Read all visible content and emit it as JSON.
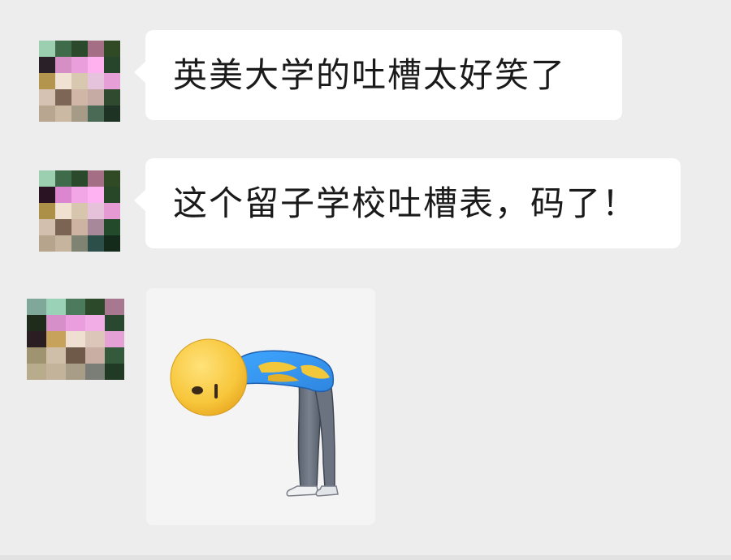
{
  "messages": [
    {
      "type": "text",
      "text": "英美大学的吐槽太好笑了",
      "avatar": {
        "colors": [
          "#9ccfb0",
          "#3f6b4a",
          "#2b4a2c",
          "#a46f84",
          "#2f4a24",
          "#2a2028",
          "#d58fc5",
          "#ea9fdc",
          "#ffb0ef",
          "#27452b",
          "#b4954e",
          "#f1e1d2",
          "#d9c8b0",
          "#e6c3dd",
          "#e79fd8",
          "#d6c2b2",
          "#7e6656",
          "#cfb6a6",
          "#c6aba4",
          "#2f4a2f",
          "#b8a690",
          "#cbb9a4",
          "#a69b86",
          "#4a6a56",
          "#1f3324"
        ]
      }
    },
    {
      "type": "text",
      "text": "这个留子学校吐槽表，码了！",
      "avatar": {
        "colors": [
          "#9ccfb0",
          "#3f6b4a",
          "#2b4a2c",
          "#a46f84",
          "#2f4a24",
          "#2a1424",
          "#dc86cf",
          "#f3a6e6",
          "#ffb2f1",
          "#284628",
          "#ad9048",
          "#efe0d0",
          "#d7c6ad",
          "#e5c1da",
          "#e59ad4",
          "#d2bfae",
          "#7b6452",
          "#ccb3a2",
          "#a7889b",
          "#234a2a",
          "#b7a48d",
          "#c6b49e",
          "#7f8372",
          "#2d4f4a",
          "#142b1c"
        ]
      }
    },
    {
      "type": "sticker",
      "sticker": "bowing-person-emoji",
      "avatar": {
        "colors": [
          "#7fa89a",
          "#9ad2b8",
          "#4c7a5d",
          "#2c4a29",
          "#a77890",
          "#1f2c1c",
          "#d78fca",
          "#ea9ede",
          "#f2ade6",
          "#2a4830",
          "#2a1e22",
          "#c7a25a",
          "#efdfd0",
          "#dcc6ba",
          "#e5a1d6",
          "#a09470",
          "#cfbea8",
          "#6f5a4a",
          "#c8aea3",
          "#325a3b",
          "#b9ac8c",
          "#c2b39a",
          "#a89d86",
          "#7a7e77",
          "#213a26"
        ]
      }
    }
  ],
  "colors": {
    "background": "#ededed",
    "bubble": "#ffffff",
    "text": "#1a1a1a",
    "sticker_background": "#f4f4f4"
  }
}
